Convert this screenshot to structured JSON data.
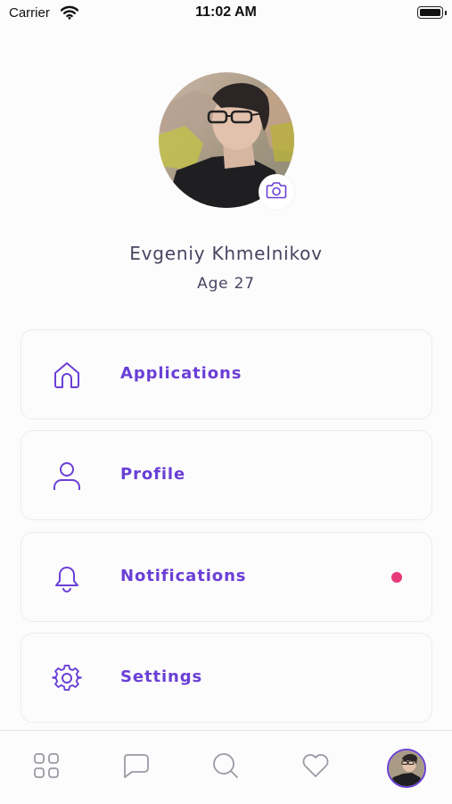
{
  "status_bar": {
    "carrier": "Carrier",
    "time": "11:02 AM",
    "battery_level": 1.0
  },
  "profile": {
    "name": "Evgeniy Khmelnikov",
    "age": "Age 27",
    "avatar_icon": "user-photo",
    "camera_icon": "camera-icon"
  },
  "menu": {
    "items": [
      {
        "label": "Applications",
        "icon": "home-icon"
      },
      {
        "label": "Profile",
        "icon": "user-icon"
      },
      {
        "label": "Notifications",
        "icon": "bell-icon",
        "badge": true
      },
      {
        "label": "Settings",
        "icon": "gear-icon"
      }
    ]
  },
  "tabbar": {
    "tabs": [
      "grid-icon",
      "chat-icon",
      "search-icon",
      "heart-icon",
      "avatar"
    ],
    "active": "avatar"
  },
  "colors": {
    "accent": "#6a3fd6",
    "text_dark": "#4a4460",
    "badge": "#e83a7b",
    "icon_gray": "#9a9aa3"
  }
}
